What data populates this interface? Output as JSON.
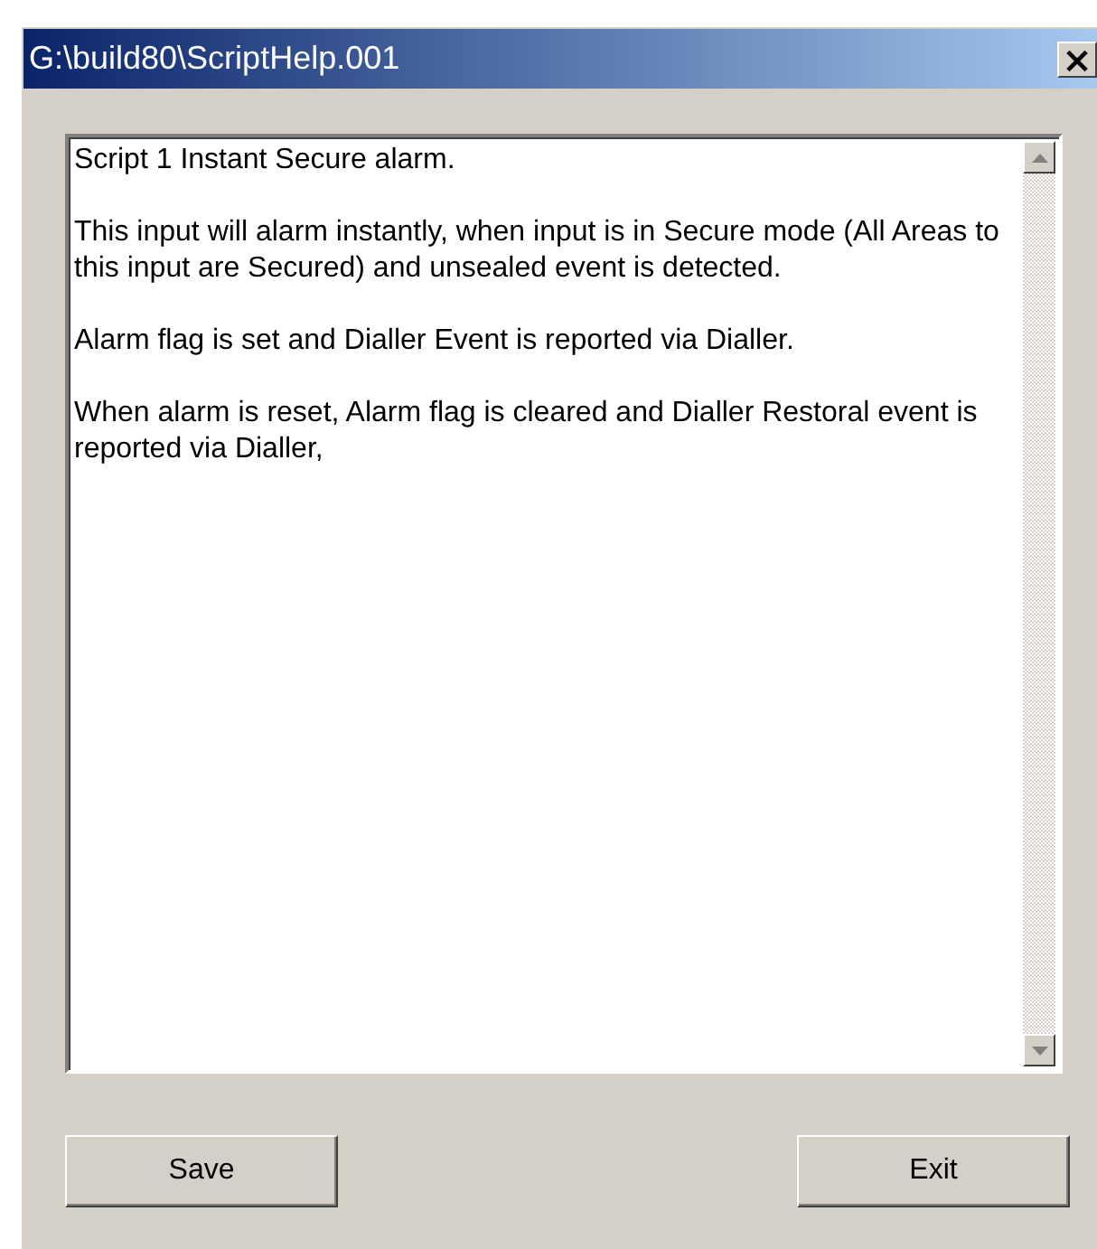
{
  "window": {
    "title": "G:\\build80\\ScriptHelp.001",
    "close": "×"
  },
  "help_text": {
    "paragraphs": [
      "Script 1 Instant Secure alarm.",
      "This input will alarm instantly, when input is in Secure mode (All Areas to this input are Secured) and unsealed event is detected.",
      "Alarm flag is set and Dialler Event is reported via Dialler.",
      "When alarm is reset, Alarm flag is cleared and Dialler Restoral event is reported via Dialler,"
    ]
  },
  "buttons": [
    {
      "label": "Save"
    },
    {
      "label": "Exit"
    }
  ]
}
